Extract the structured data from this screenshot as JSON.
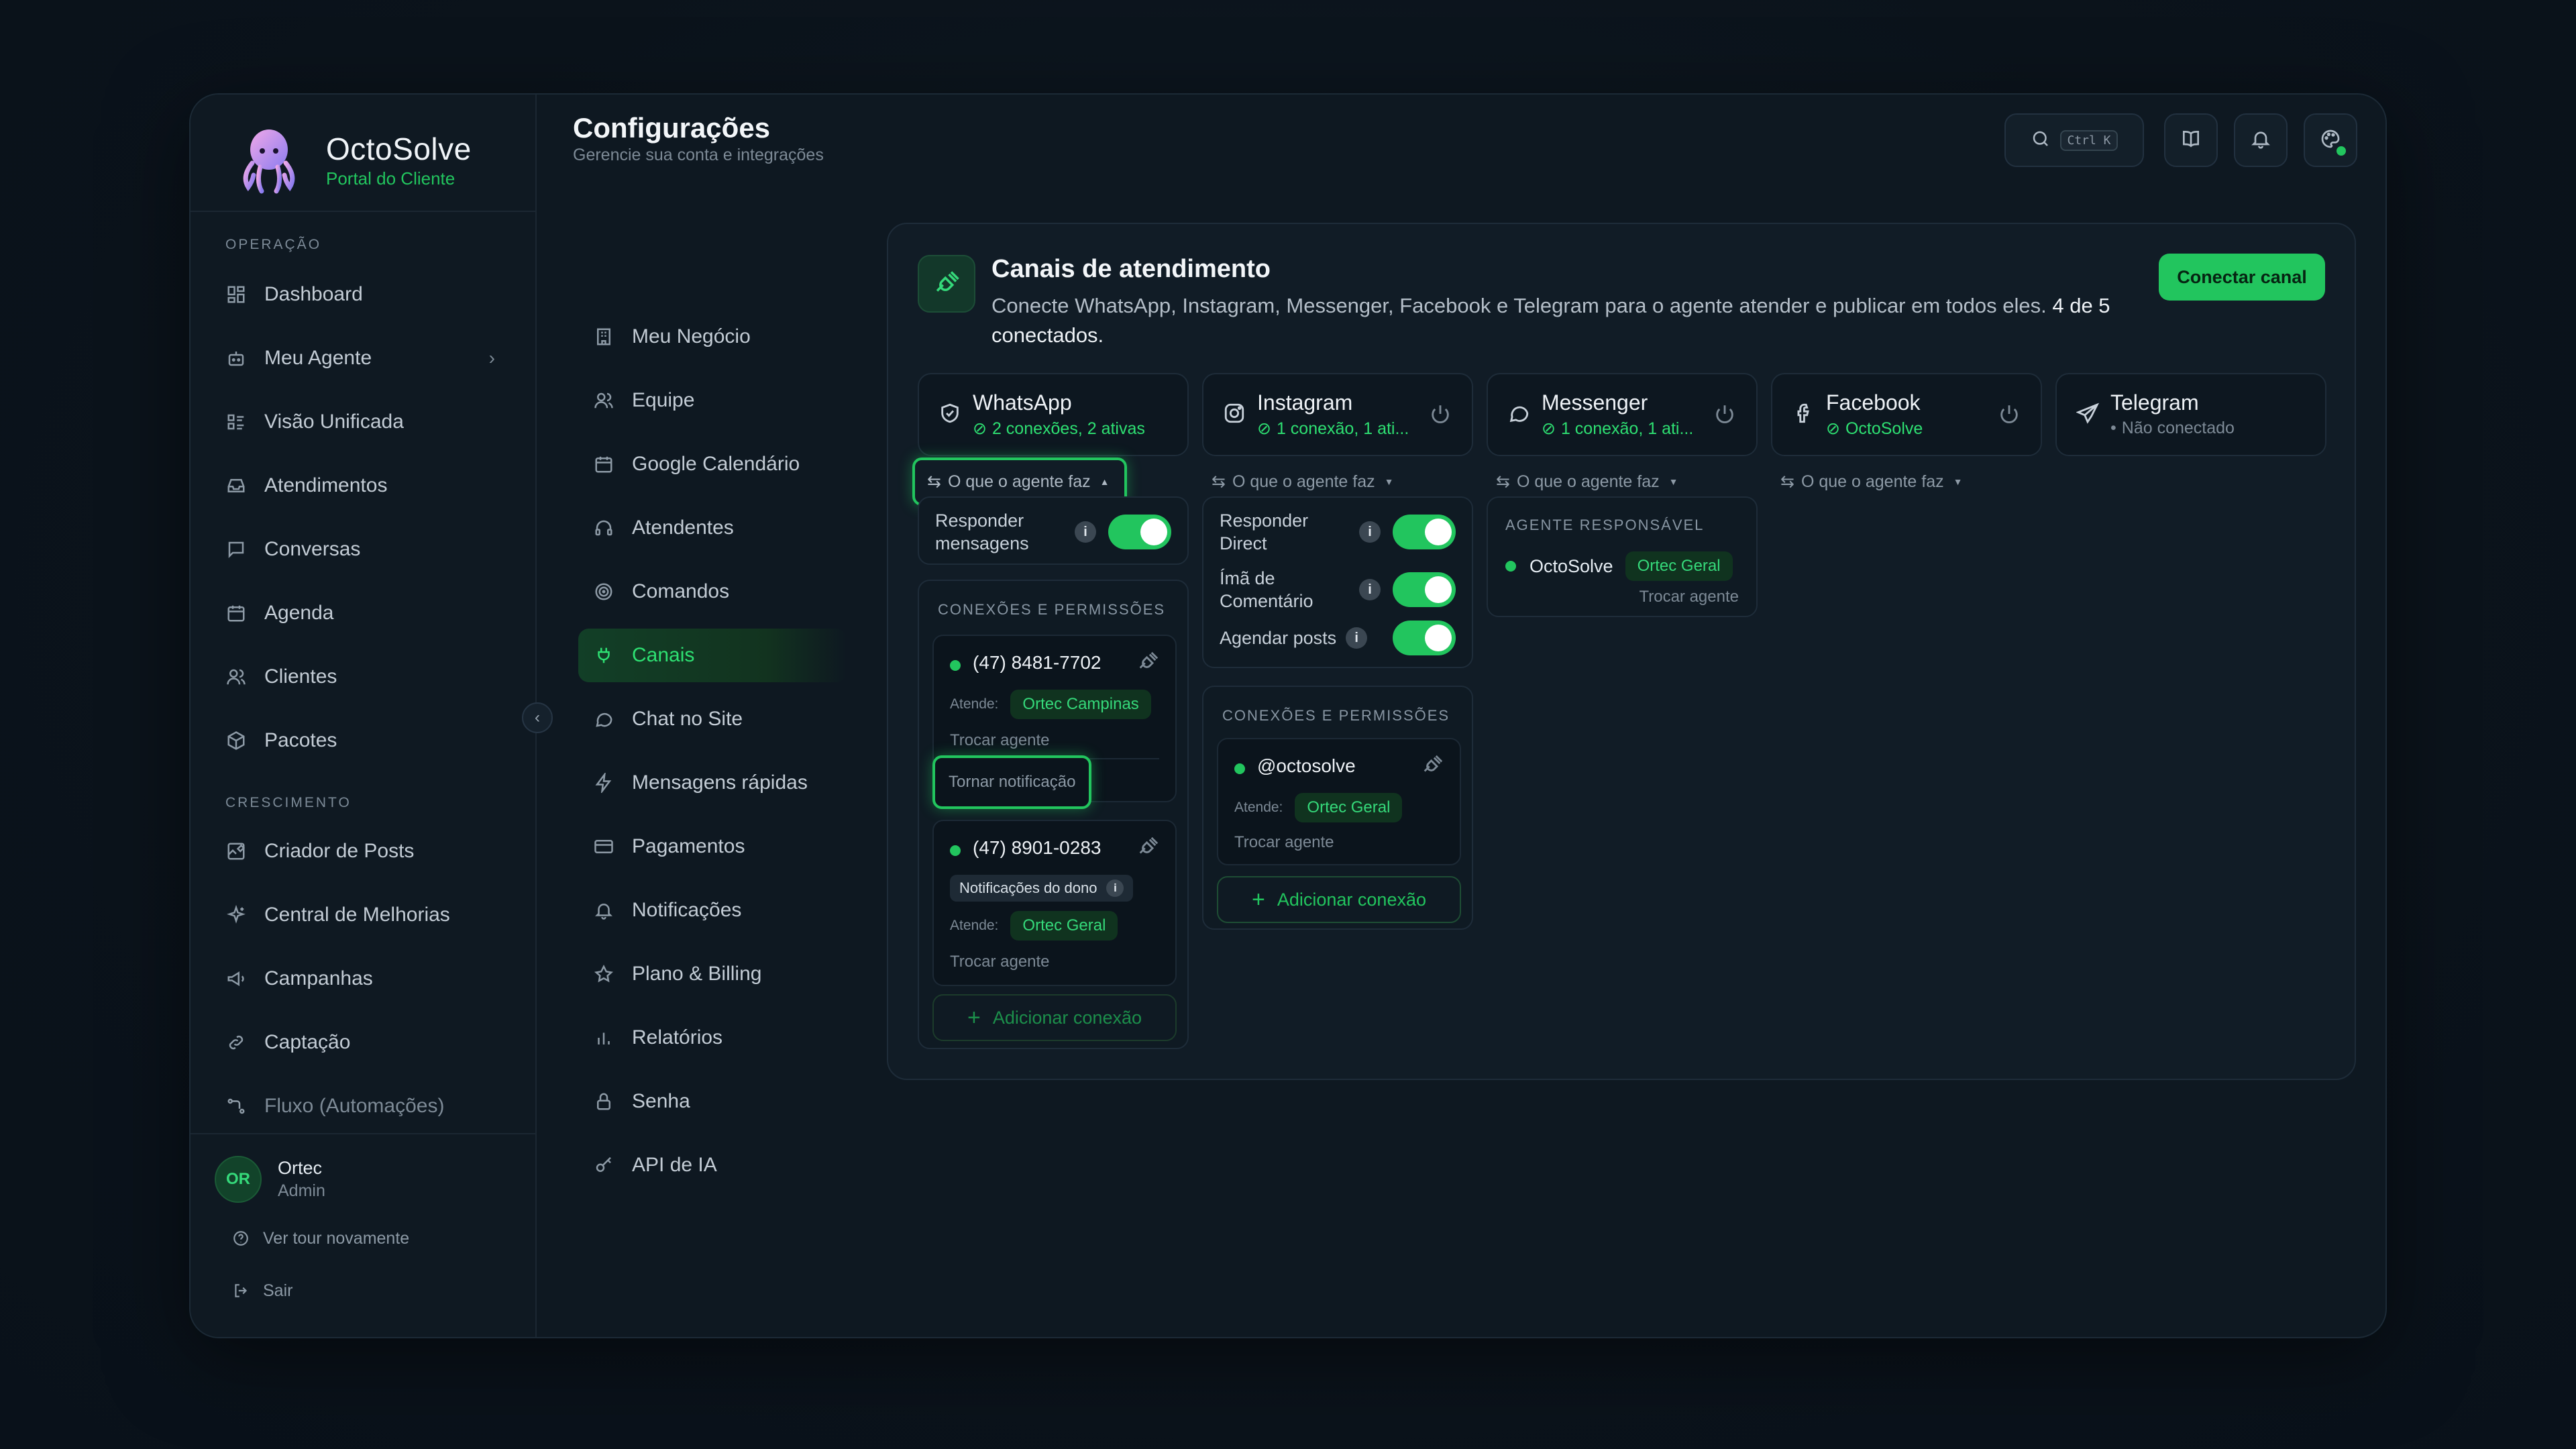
{
  "brand": {
    "name": "OctoSolve",
    "subtitle": "Portal do Cliente"
  },
  "sidebar": {
    "sections": [
      {
        "title": "OPERAÇÃO",
        "items": [
          {
            "label": "Dashboard",
            "icon": "grid-icon"
          },
          {
            "label": "Meu Agente",
            "icon": "bot-icon",
            "has_chevron": true
          },
          {
            "label": "Visão Unificada",
            "icon": "list-icon"
          },
          {
            "label": "Atendimentos",
            "icon": "inbox-icon"
          },
          {
            "label": "Conversas",
            "icon": "chat-icon"
          },
          {
            "label": "Agenda",
            "icon": "calendar-icon"
          },
          {
            "label": "Clientes",
            "icon": "users-icon"
          },
          {
            "label": "Pacotes",
            "icon": "package-icon"
          }
        ]
      },
      {
        "title": "CRESCIMENTO",
        "items": [
          {
            "label": "Criador de Posts",
            "icon": "edit-image-icon"
          },
          {
            "label": "Central de Melhorias",
            "icon": "sparkles-icon"
          },
          {
            "label": "Campanhas",
            "icon": "megaphone-icon"
          },
          {
            "label": "Captação",
            "icon": "link-icon"
          },
          {
            "label": "Fluxo (Automações)",
            "icon": "flow-icon"
          }
        ]
      }
    ],
    "user": {
      "initials": "OR",
      "name": "Ortec",
      "role": "Admin"
    },
    "tour_label": "Ver tour novamente",
    "logout_label": "Sair"
  },
  "header": {
    "title": "Configurações",
    "subtitle": "Gerencie sua conta e integrações",
    "search_shortcut": "Ctrl K"
  },
  "settings_nav": [
    {
      "label": "Meu Negócio",
      "icon": "building-icon"
    },
    {
      "label": "Equipe",
      "icon": "users-icon"
    },
    {
      "label": "Google Calendário",
      "icon": "calendar-icon"
    },
    {
      "label": "Atendentes",
      "icon": "headset-icon"
    },
    {
      "label": "Comandos",
      "icon": "target-icon"
    },
    {
      "label": "Canais",
      "icon": "plug-icon",
      "active": true
    },
    {
      "label": "Chat no Site",
      "icon": "chat-icon"
    },
    {
      "label": "Mensagens rápidas",
      "icon": "zap-icon"
    },
    {
      "label": "Pagamentos",
      "icon": "card-icon"
    },
    {
      "label": "Notificações",
      "icon": "bell-icon"
    },
    {
      "label": "Plano & Billing",
      "icon": "star-icon"
    },
    {
      "label": "Relatórios",
      "icon": "bar-chart-icon"
    },
    {
      "label": "Senha",
      "icon": "lock-icon"
    },
    {
      "label": "API de IA",
      "icon": "key-icon"
    }
  ],
  "panel": {
    "title": "Canais de atendimento",
    "description": "Conecte WhatsApp, Instagram, Messenger, Facebook e Telegram para o agente atender e publicar em todos eles.",
    "connected_count": "4 de 5 conectados.",
    "connect_button": "Conectar canal",
    "agent_toggle_label": "O que o agente faz",
    "channels": [
      {
        "name": "WhatsApp",
        "status": "2 conexões, 2 ativas",
        "icon": "whatsapp-icon",
        "connected": true
      },
      {
        "name": "Instagram",
        "status": "1 conexão, 1 ati...",
        "icon": "instagram-icon",
        "connected": true
      },
      {
        "name": "Messenger",
        "status": "1 conexão, 1 ati...",
        "icon": "messenger-icon",
        "connected": true
      },
      {
        "name": "Facebook",
        "status": "OctoSolve",
        "icon": "facebook-icon",
        "connected": true
      },
      {
        "name": "Telegram",
        "status": "Não conectado",
        "icon": "telegram-icon",
        "connected": false
      }
    ],
    "whatsapp": {
      "toggles": [
        {
          "label": "Responder mensagens",
          "on": true
        }
      ],
      "section_title": "CONEXÕES E PERMISSÕES",
      "connections": [
        {
          "number": "(47) 8481-7702",
          "atende_label": "Atende:",
          "agent": "Ortec Campinas",
          "swap": "Trocar agente",
          "notify": "Tornar notificação"
        },
        {
          "number": "(47) 8901-0283",
          "owner_badge": "Notificações do dono",
          "atende_label": "Atende:",
          "agent": "Ortec Geral",
          "swap": "Trocar agente"
        }
      ],
      "add_connection": "Adicionar conexão"
    },
    "instagram": {
      "toggles": [
        {
          "label": "Responder Direct",
          "on": true
        },
        {
          "label": "Ímã de Comentário",
          "on": true
        },
        {
          "label": "Agendar posts",
          "on": true
        }
      ],
      "section_title": "CONEXÕES E PERMISSÕES",
      "connections": [
        {
          "handle": "@octosolve",
          "atende_label": "Atende:",
          "agent": "Ortec Geral",
          "swap": "Trocar agente"
        }
      ],
      "add_connection": "Adicionar conexão"
    },
    "messenger": {
      "responsible_title": "AGENTE RESPONSÁVEL",
      "agent_name": "OctoSolve",
      "agent_badge": "Ortec Geral",
      "swap": "Trocar agente"
    }
  },
  "colors": {
    "accent": "#22c55e",
    "background": "#0e1821",
    "card": "#111c26"
  }
}
